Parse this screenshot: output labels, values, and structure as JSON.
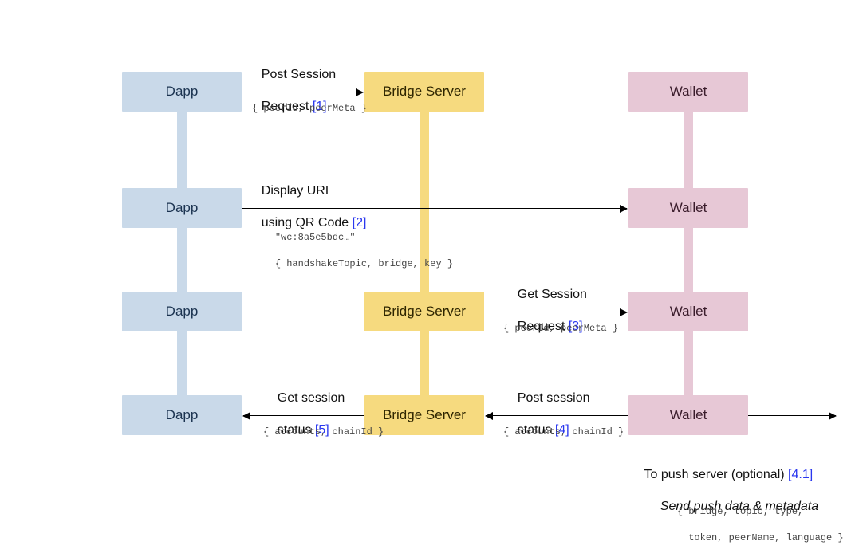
{
  "columns": {
    "dapp": "Dapp",
    "bridge": "Bridge Server",
    "wallet": "Wallet"
  },
  "steps": {
    "s1": {
      "title_l1": "Post Session",
      "title_l2": "Request ",
      "ref": "[1]",
      "payload": "{ peerId, peerMeta }"
    },
    "s2": {
      "title_l1": "Display URI",
      "title_l2": "using QR Code ",
      "ref": "[2]",
      "payload_l1": "\"wc:8a5e5bdc…\"",
      "payload_l2": "{ handshakeTopic, bridge, key }"
    },
    "s3": {
      "title_l1": "Get Session",
      "title_l2": "Request ",
      "ref": "[3]",
      "payload": "{ peerId, peerMeta }"
    },
    "s4": {
      "title_l1": "Post session",
      "title_l2": "status ",
      "ref": "[4]",
      "payload": "{ accounts, chainId }"
    },
    "s5": {
      "title_l1": "Get session",
      "title_l2": "status ",
      "ref": "[5]",
      "payload": "{ accounts, chainId }"
    },
    "s41": {
      "title": "To push server (optional) ",
      "ref": "[4.1]",
      "subtitle": "Send push data & metadata",
      "payload_l1": "{ bridge, topic, type,",
      "payload_l2": "  token, peerName, language }"
    }
  }
}
